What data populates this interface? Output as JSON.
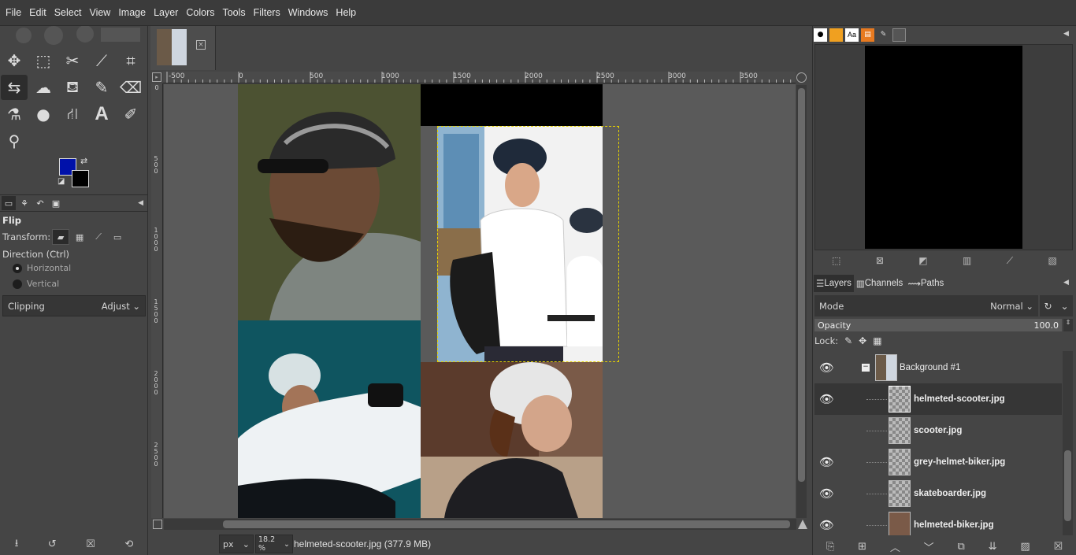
{
  "menubar": {
    "items": [
      "File",
      "Edit",
      "Select",
      "View",
      "Image",
      "Layer",
      "Colors",
      "Tools",
      "Filters",
      "Windows",
      "Help"
    ]
  },
  "tool_options": {
    "title": "Flip",
    "transform_label": "Transform:",
    "direction_label": "Direction  (Ctrl)",
    "horizontal": "Horizontal",
    "vertical": "Vertical",
    "clipping_label": "Clipping",
    "clipping_value": "Adjust"
  },
  "colors": {
    "foreground": "#0011aa",
    "background": "#000000",
    "selection": "#e6d200"
  },
  "ruler": {
    "h_labels": [
      "-500",
      "0",
      "500",
      "1000",
      "1500",
      "2000",
      "2500",
      "3000",
      "3500"
    ],
    "v_labels": [
      "0",
      "500",
      "1000",
      "1500",
      "2000",
      "2500"
    ]
  },
  "status": {
    "unit": "px",
    "zoom": "18.2 %",
    "file_info": "helmeted-scooter.jpg (377.9 MB)"
  },
  "layers_panel": {
    "tabs": [
      "Layers",
      "Channels",
      "Paths"
    ],
    "mode_label": "Mode",
    "mode_value": "Normal",
    "opacity_label": "Opacity",
    "opacity_value": "100.0",
    "lock_label": "Lock:",
    "layers": [
      {
        "name": "Background #1",
        "visible": true,
        "group": true
      },
      {
        "name": "helmeted-scooter.jpg",
        "visible": true,
        "selected": true
      },
      {
        "name": "scooter.jpg",
        "visible": false
      },
      {
        "name": "grey-helmet-biker.jpg",
        "visible": true
      },
      {
        "name": "skateboarder.jpg",
        "visible": true
      },
      {
        "name": "helmeted-biker.jpg",
        "visible": true
      }
    ]
  }
}
